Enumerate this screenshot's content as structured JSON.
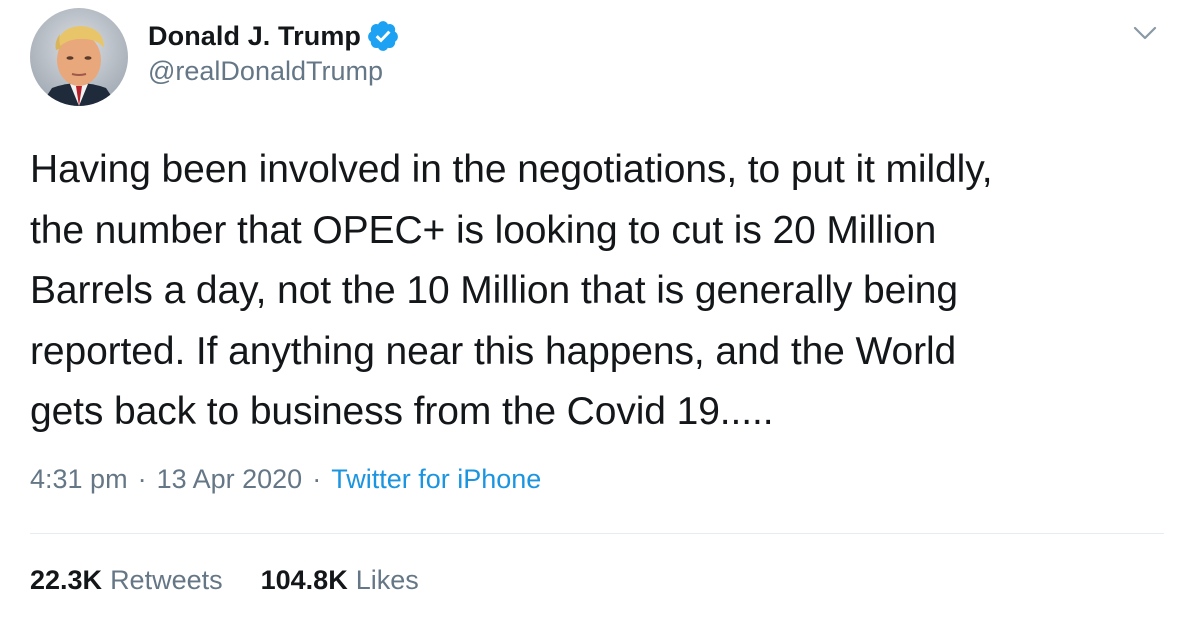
{
  "author": {
    "display_name": "Donald J. Trump",
    "handle": "@realDonaldTrump",
    "verified_icon": "verified-badge-icon",
    "avatar_icon": "profile-photo"
  },
  "menu_icon": "chevron-down-icon",
  "tweet": {
    "lines": [
      "Having been involved in the negotiations, to put it mildly,",
      "the number that OPEC+ is looking to cut is 20 Million",
      "Barrels a day, not the 10 Million that is generally being",
      "reported. If anything near this happens, and the World",
      "gets back to business from the Covid 19....."
    ]
  },
  "meta": {
    "time": "4:31 pm",
    "date": "13 Apr 2020",
    "separator": "·",
    "source": "Twitter for iPhone"
  },
  "stats": {
    "retweets_count": "22.3K",
    "retweets_label": "Retweets",
    "likes_count": "104.8K",
    "likes_label": "Likes"
  },
  "colors": {
    "text": "#14171a",
    "secondary": "#657786",
    "accent": "#1b95e0",
    "verified": "#1da1f2",
    "divider": "#e6ecf0"
  }
}
